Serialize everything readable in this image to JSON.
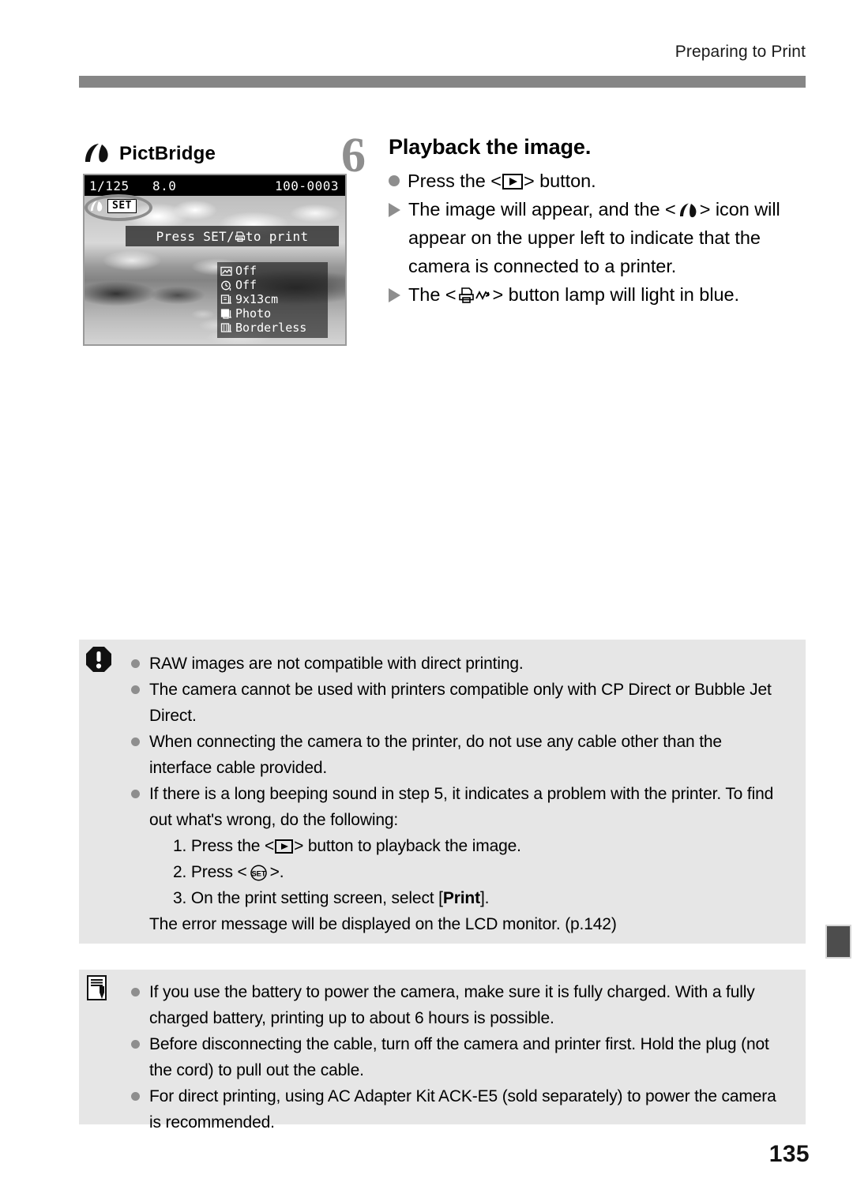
{
  "header": {
    "title": "Preparing to Print"
  },
  "pictbridge_panel": {
    "logo_icon": "pictbridge-logo-icon",
    "label": "PictBridge",
    "lcd": {
      "shutter_speed": "1/125",
      "aperture": "8.0",
      "file_number": "100-0003",
      "connection_icon": "pictbridge-icon",
      "set_badge": "SET",
      "highlight": "ellipse-highlight",
      "prompt_prefix": "Press SET/",
      "prompt_icon": "printer-icon",
      "prompt_suffix": " to print",
      "settings": [
        {
          "icon": "print-effect-icon",
          "value": "Off"
        },
        {
          "icon": "date-imprint-icon",
          "value": "Off"
        },
        {
          "icon": "paper-size-icon",
          "value": "9x13cm"
        },
        {
          "icon": "paper-type-icon",
          "value": "Photo"
        },
        {
          "icon": "page-layout-icon",
          "value": "Borderless"
        }
      ]
    }
  },
  "step": {
    "number": "6",
    "title": "Playback the image.",
    "items": [
      {
        "marker": "dot",
        "parts": [
          {
            "t": "text",
            "v": "Press the <"
          },
          {
            "t": "icon",
            "v": "playback-button-icon"
          },
          {
            "t": "text",
            "v": "> button."
          }
        ]
      },
      {
        "marker": "triangle",
        "parts": [
          {
            "t": "text",
            "v": "The image will appear, and the <"
          },
          {
            "t": "icon",
            "v": "pictbridge-icon"
          },
          {
            "t": "text",
            "v": "> icon will appear on the upper left to indicate that the camera is connected to a printer."
          }
        ]
      },
      {
        "marker": "triangle",
        "parts": [
          {
            "t": "text",
            "v": "The <"
          },
          {
            "t": "icon",
            "v": "print-share-button-icon"
          },
          {
            "t": "text",
            "v": "> button lamp will light in blue."
          }
        ]
      }
    ]
  },
  "warning_box": {
    "icon": "caution-icon",
    "items": [
      "RAW images are not compatible with direct printing.",
      "The camera cannot be used with printers compatible only with CP Direct or Bubble Jet Direct.",
      "When connecting the camera to the printer, do not use any cable other than the interface cable provided."
    ],
    "beep_item": {
      "lead": "If there is a long beeping sound in step 5, it indicates a problem with the printer. To find out what's wrong, do the following:",
      "steps": [
        {
          "num": "1.",
          "pre": "Press the <",
          "icon": "playback-button-icon",
          "post": "> button to playback the image."
        },
        {
          "num": "2.",
          "pre": "Press <",
          "icon": "set-button-icon",
          "post": ">."
        },
        {
          "num": "3.",
          "pre": "On the print setting screen, select [",
          "bold": "Print",
          "post": "]."
        }
      ],
      "closing": "The error message will be displayed on the LCD monitor. (p.142)"
    }
  },
  "note_box": {
    "icon": "note-icon",
    "items": [
      "If you use the battery to power the camera, make sure it is fully charged. With a fully charged battery, printing up to about 6 hours is possible.",
      "Before disconnecting the cable, turn off the camera and printer first. Hold the plug (not the cord) to pull out the cable.",
      "For direct printing, using AC Adapter Kit ACK-E5 (sold separately) to power the camera is recommended."
    ]
  },
  "side_tab": {
    "name": "chapter-tab"
  },
  "page_number": "135",
  "colors": {
    "header_rule": "#868686",
    "callout_bg": "#e6e6e6",
    "marker_gray": "#8e8e8e",
    "tab_dark": "#4d4d4d"
  }
}
